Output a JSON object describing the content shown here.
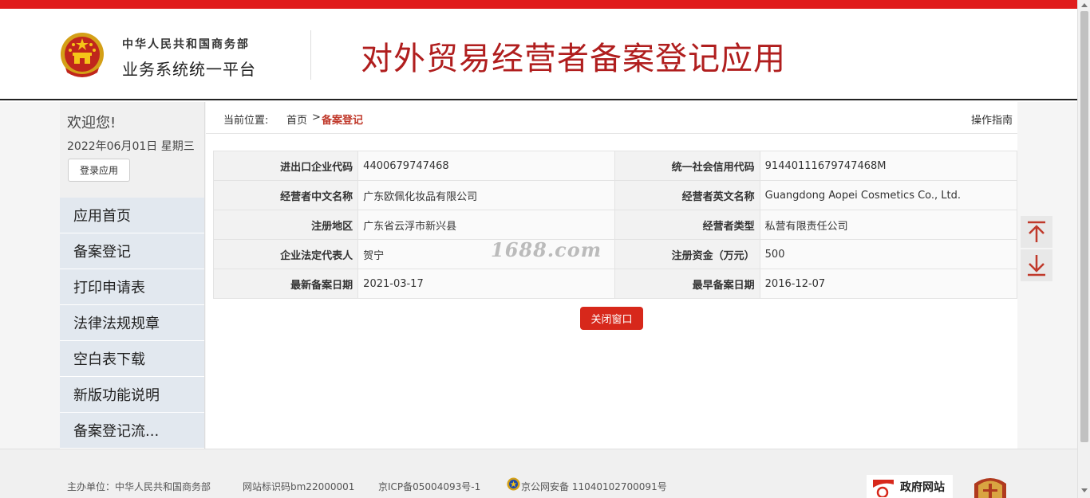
{
  "header": {
    "org_line1": "中华人民共和国商务部",
    "org_line2": "业务系统统一平台",
    "app_title": "对外贸易经营者备案登记应用",
    "accent_color": "#e01b1b",
    "title_color": "#b01e1e",
    "emblem_icon": "national-emblem-icon"
  },
  "sidebar": {
    "welcome": "欢迎您!",
    "date": "2022年06月01日 星期三",
    "login_button": "登录应用",
    "items": [
      {
        "label": "应用首页"
      },
      {
        "label": "备案登记"
      },
      {
        "label": "打印申请表"
      },
      {
        "label": "法律法规规章"
      },
      {
        "label": "空白表下载"
      },
      {
        "label": "新版功能说明"
      },
      {
        "label": "备案登记流..."
      }
    ]
  },
  "breadcrumb": {
    "label": "当前位置:",
    "home": "首页",
    "separator": ">",
    "current": "备案登记",
    "guide": "操作指南"
  },
  "table": {
    "rows": [
      {
        "label1": "进出口企业代码",
        "value1": "4400679747468",
        "label2": "统一社会信用代码",
        "value2": "91440111679747468M"
      },
      {
        "label1": "经营者中文名称",
        "value1": "广东欧佩化妆品有限公司",
        "label2": "经营者英文名称",
        "value2": "Guangdong Aopei Cosmetics Co., Ltd."
      },
      {
        "label1": "注册地区",
        "value1": "广东省云浮市新兴县",
        "label2": "经营者类型",
        "value2": "私营有限责任公司"
      },
      {
        "label1": "企业法定代表人",
        "value1": "贺宁",
        "label2": "注册资金（万元）",
        "value2": "500"
      },
      {
        "label1": "最新备案日期",
        "value1": "2021-03-17",
        "label2": "最早备案日期",
        "value2": "2016-12-07"
      }
    ]
  },
  "watermark": "1688.com",
  "close_button": "关闭窗口",
  "float_buttons": {
    "up_icon": "arrow-to-top-icon",
    "down_icon": "arrow-to-bottom-icon"
  },
  "footer": {
    "sponsor": "主办单位：中华人民共和国商务部",
    "site_id": "网站标识码bm22000001",
    "icp": "京ICP备05004093号-1",
    "police": "京公网安备 11040102700091号",
    "gov_badge": "政府网站"
  }
}
